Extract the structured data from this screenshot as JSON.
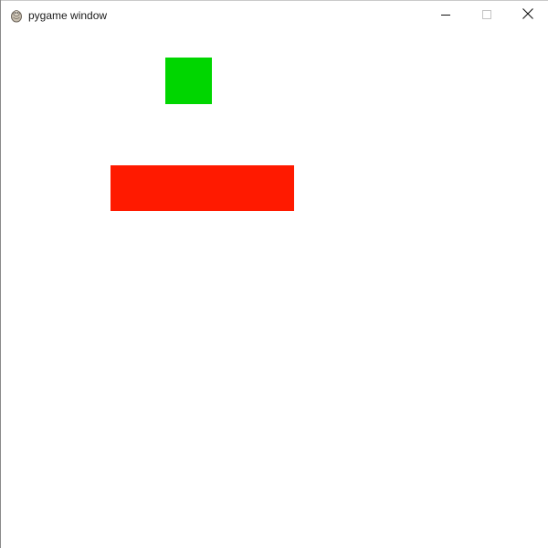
{
  "window": {
    "title": "pygame window",
    "app_icon": "pygame-snake-icon",
    "controls": {
      "minimize_icon": "minimize-icon",
      "maximize_icon": "maximize-icon",
      "close_icon": "close-icon"
    }
  },
  "canvas": {
    "background": "#ffffff",
    "sprites": [
      {
        "name": "green-square",
        "color": "#00d600"
      },
      {
        "name": "red-rectangle",
        "color": "#ff1a00"
      }
    ]
  }
}
